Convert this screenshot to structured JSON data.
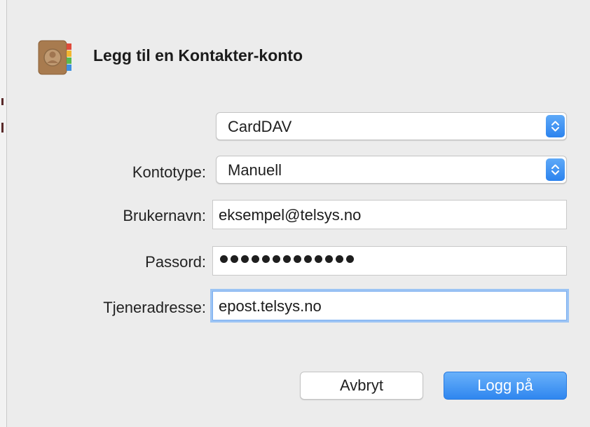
{
  "dialog": {
    "title": "Legg til en Kontakter-konto",
    "app_icon": "contacts-app-icon"
  },
  "form": {
    "account_protocol": {
      "selected": "CardDAV"
    },
    "account_type": {
      "label": "Kontotype:",
      "selected": "Manuell"
    },
    "username": {
      "label": "Brukernavn:",
      "value": "eksempel@telsys.no"
    },
    "password": {
      "label": "Passord:",
      "masked_length": 13
    },
    "server_address": {
      "label": "Tjeneradresse:",
      "value": "epost.telsys.no"
    }
  },
  "buttons": {
    "cancel_label": "Avbryt",
    "login_label": "Logg på"
  },
  "colors": {
    "accent": "#2f86ef",
    "focus_ring": "#9cc4f4",
    "background": "#ececec"
  }
}
